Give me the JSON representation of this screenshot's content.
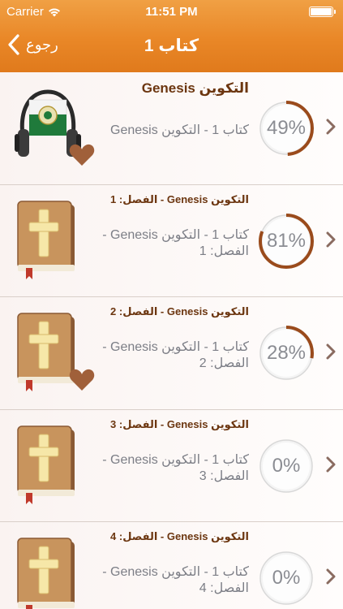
{
  "status_bar": {
    "carrier": "Carrier",
    "time": "11:51 PM"
  },
  "nav": {
    "back_label": "رجوع",
    "title": "كتاب 1"
  },
  "rows": [
    {
      "title": "التكوين Genesis",
      "subtitle": "كتاب 1 - التكوين Genesis",
      "progress_label": "49%",
      "progress": 0.49,
      "thumbnail": "headphones-flag-icon",
      "favorite": true
    },
    {
      "title": "التكوين Genesis - الفصل: 1",
      "subtitle": "كتاب 1 - التكوين Genesis - الفصل: 1",
      "progress_label": "81%",
      "progress": 0.81,
      "thumbnail": "bible-book-icon",
      "favorite": false
    },
    {
      "title": "التكوين Genesis - الفصل: 2",
      "subtitle": "كتاب 1 - التكوين Genesis - الفصل: 2",
      "progress_label": "28%",
      "progress": 0.28,
      "thumbnail": "bible-book-icon",
      "favorite": true
    },
    {
      "title": "التكوين Genesis - الفصل: 3",
      "subtitle": "كتاب 1 - التكوين Genesis - الفصل: 3",
      "progress_label": "0%",
      "progress": 0,
      "thumbnail": "bible-book-icon",
      "favorite": false
    },
    {
      "title": "التكوين Genesis - الفصل: 4",
      "subtitle": "كتاب 1 - التكوين Genesis - الفصل: 4",
      "progress_label": "0%",
      "progress": 0,
      "thumbnail": "bible-book-icon",
      "favorite": false
    }
  ],
  "colors": {
    "header_orange": "#e98727",
    "title_brown": "#6c3610",
    "progress_arc": "#9a4b1c",
    "heart": "#a0603a",
    "subtitle_gray": "#7c7e86"
  }
}
